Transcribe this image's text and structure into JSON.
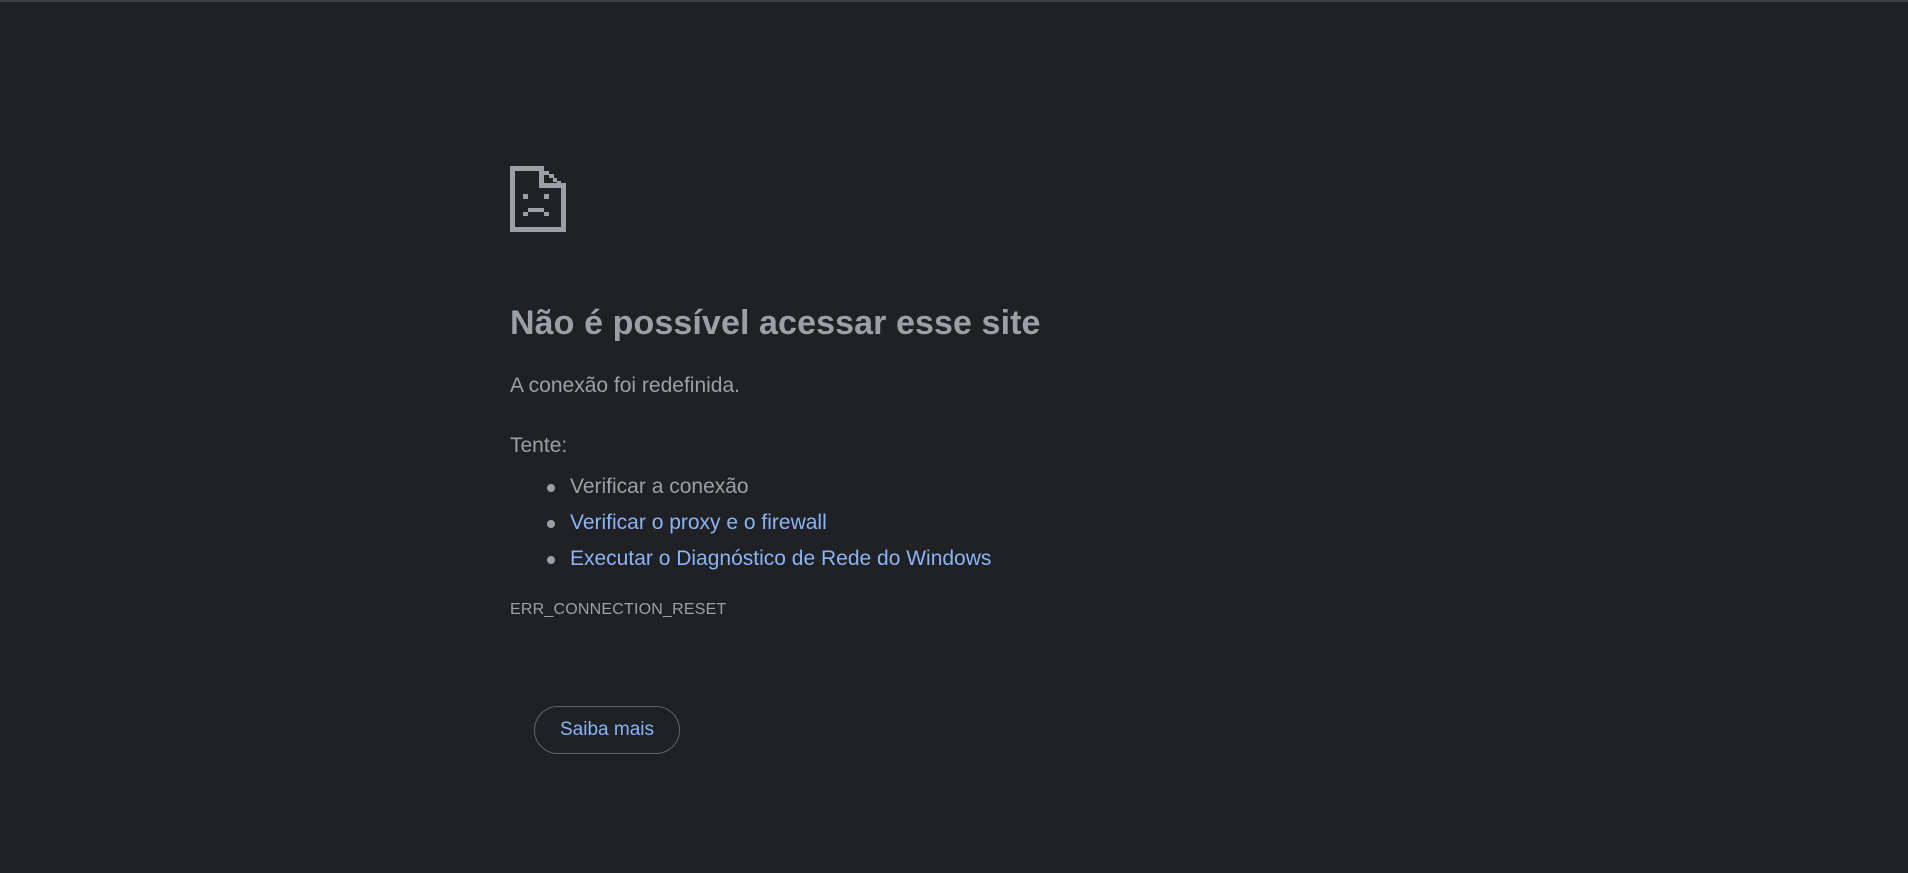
{
  "theme": {
    "background": "#202124",
    "text": "#9aa0a6",
    "link": "#8ab4f8",
    "border": "#5f6368"
  },
  "error_page": {
    "icon": "sad-document-icon",
    "title": "Não é possível acessar esse site",
    "description": "A conexão foi redefinida.",
    "try_label": "Tente:",
    "suggestions": [
      {
        "text": "Verificar a conexão",
        "is_link": false
      },
      {
        "text": "Verificar o proxy e o firewall",
        "is_link": true
      },
      {
        "text": "Executar o Diagnóstico de Rede do Windows",
        "is_link": true
      }
    ],
    "error_code": "ERR_CONNECTION_RESET",
    "learn_more_label": "Saiba mais"
  }
}
